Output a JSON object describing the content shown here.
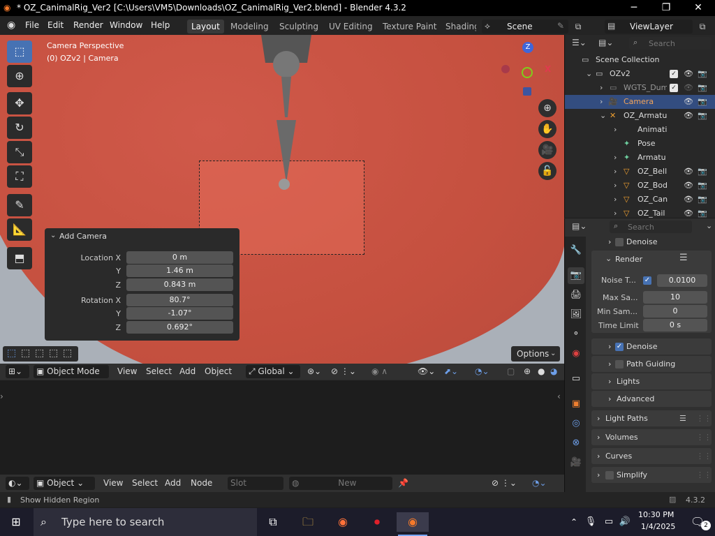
{
  "titlebar": {
    "title": "* OZ_CanimalRig_Ver2 [C:\\Users\\VM5\\Downloads\\OZ_CanimalRig_Ver2.blend] - Blender 4.3.2",
    "minimize": "─",
    "maximize": "❐",
    "close": "✕"
  },
  "menu": {
    "items": [
      "File",
      "Edit",
      "Render",
      "Window",
      "Help"
    ]
  },
  "workspaces": [
    "Layout",
    "Modeling",
    "Sculpting",
    "UV Editing",
    "Texture Paint",
    "Shading"
  ],
  "scene": {
    "label": "Scene",
    "view_layer": "ViewLayer"
  },
  "viewport": {
    "overlay_line1": "Camera Perspective",
    "overlay_line2": "(0) OZv2 | Camera",
    "gizmo": {
      "z": "Z",
      "x": "X"
    },
    "options_label": "Options"
  },
  "add_camera": {
    "title": "Add Camera",
    "location_label": "Location X",
    "y_label": "Y",
    "z_label": "Z",
    "rotation_label": "Rotation X",
    "location": {
      "x": "0 m",
      "y": "1.46 m",
      "z": "0.843 m"
    },
    "rotation": {
      "x": "80.7°",
      "y": "-1.07°",
      "z": "0.692°"
    }
  },
  "viewport_header": {
    "mode": "Object Mode",
    "items": [
      "View",
      "Select",
      "Add",
      "Object"
    ],
    "orientation": "Global"
  },
  "editor_header": {
    "mode": "Object",
    "items": [
      "View",
      "Select",
      "Add",
      "Node"
    ],
    "slot": "Slot",
    "new_label": "New"
  },
  "outliner": {
    "search_placeholder": "Search",
    "rows": [
      {
        "label": "Scene Collection"
      },
      {
        "label": "OZv2"
      },
      {
        "label": "WGTS_Dum"
      },
      {
        "label": "Camera"
      },
      {
        "label": "OZ_Armatu"
      },
      {
        "label": "Animati"
      },
      {
        "label": "Pose"
      },
      {
        "label": "Armatu"
      },
      {
        "label": "OZ_Bell"
      },
      {
        "label": "OZ_Bod"
      },
      {
        "label": "OZ_Can"
      },
      {
        "label": "OZ_Tail"
      }
    ]
  },
  "properties": {
    "search_placeholder": "Search",
    "denoise_top": "Denoise",
    "render_label": "Render",
    "noise_threshold_label": "Noise T...",
    "noise_threshold_value": "0.0100",
    "max_samples_label": "Max Sa...",
    "max_samples_value": "10",
    "min_samples_label": "Min Sam...",
    "min_samples_value": "0",
    "time_limit_label": "Time Limit",
    "time_limit_value": "0 s",
    "denoise": "Denoise",
    "path_guiding": "Path Guiding",
    "lights": "Lights",
    "advanced": "Advanced",
    "light_paths": "Light Paths",
    "volumes": "Volumes",
    "curves": "Curves",
    "simplify": "Simplify"
  },
  "statusbar": {
    "hint": "Show Hidden Region",
    "version": "4.3.2"
  },
  "taskbar": {
    "search_placeholder": "Type here to search",
    "time": "10:30 PM",
    "date": "1/4/2025",
    "notifications": "2"
  }
}
